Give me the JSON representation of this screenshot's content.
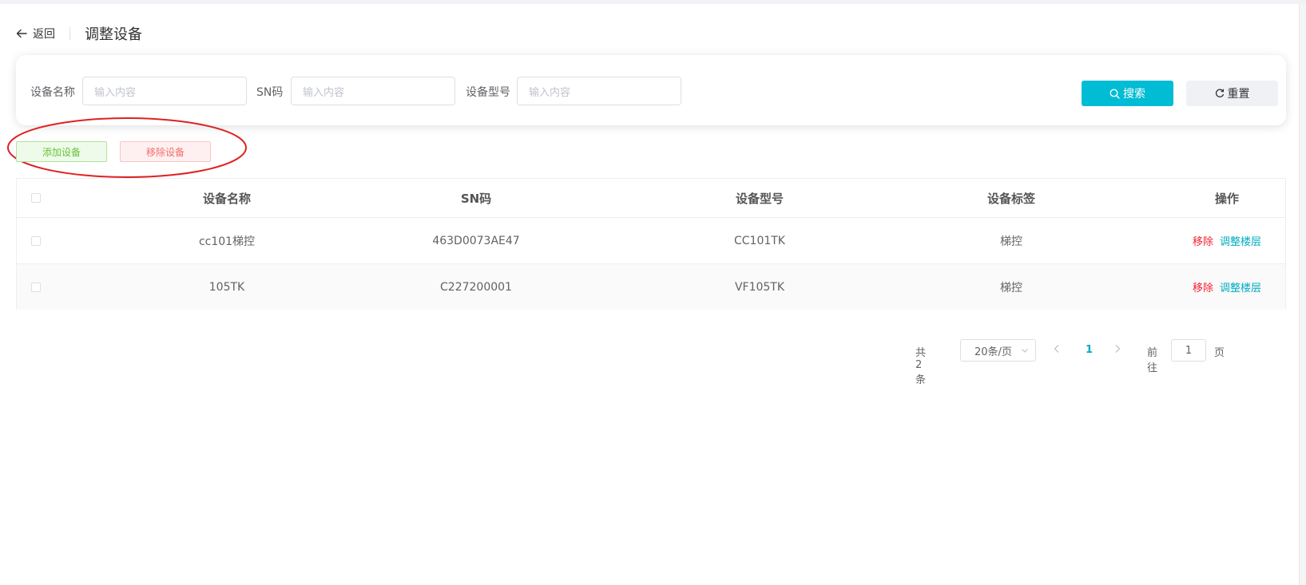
{
  "header": {
    "back_label": "返回",
    "title": "调整设备"
  },
  "search": {
    "fields": [
      {
        "label": "设备名称",
        "placeholder": "输入内容"
      },
      {
        "label": "SN码",
        "placeholder": "输入内容"
      },
      {
        "label": "设备型号",
        "placeholder": "输入内容"
      }
    ],
    "search_label": "搜索",
    "reset_label": "重置"
  },
  "actions": {
    "add_label": "添加设备",
    "remove_label": "移除设备"
  },
  "table": {
    "columns": [
      "设备名称",
      "SN码",
      "设备型号",
      "设备标签",
      "操作"
    ],
    "rows": [
      {
        "name": "cc101梯控",
        "sn": "463D0073AE47",
        "model": "CC101TK",
        "tag": "梯控",
        "op_remove": "移除",
        "op_adjust": "调整楼层"
      },
      {
        "name": "105TK",
        "sn": "C227200001",
        "model": "VF105TK",
        "tag": "梯控",
        "op_remove": "移除",
        "op_adjust": "调整楼层"
      }
    ]
  },
  "pagination": {
    "total_label": "共 2 条",
    "page_size": "20条/页",
    "current_page": "1",
    "goto_label": "前往",
    "goto_value": "1",
    "page_suffix": "页"
  },
  "colors": {
    "primary": "#00bcd4",
    "success": "#67c23a",
    "danger": "#f56c6c",
    "annotation": "#e02020"
  }
}
